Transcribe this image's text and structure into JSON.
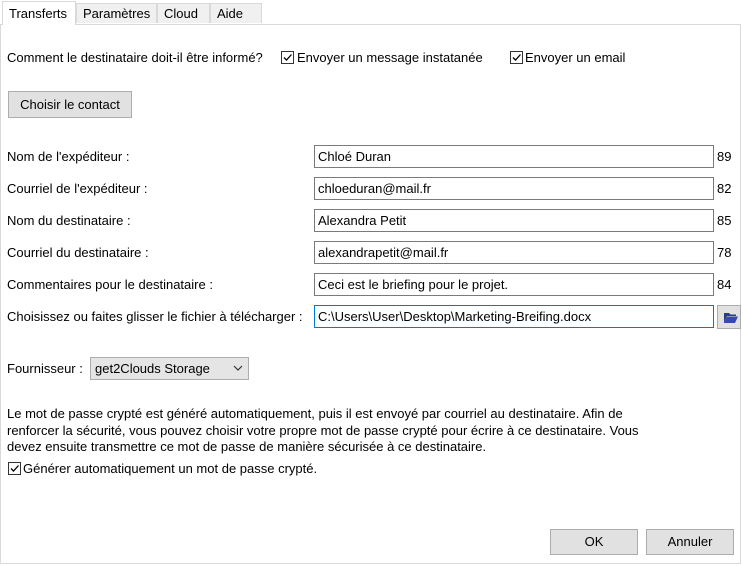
{
  "tabs": [
    {
      "label": "Transferts"
    },
    {
      "label": "Paramètres"
    },
    {
      "label": "Cloud"
    },
    {
      "label": "Aide"
    }
  ],
  "notify": {
    "question": "Comment le destinataire doit-il être informé?",
    "instant_label": "Envoyer un message instatanée",
    "instant_checked": true,
    "email_label": "Envoyer un email",
    "email_checked": true
  },
  "choose_contact_label": "Choisir le contact",
  "fields": {
    "sender_name": {
      "label": "Nom de l'expéditeur :",
      "value": "Chloé Duran",
      "count": "89"
    },
    "sender_email": {
      "label": "Courriel de l'expéditeur :",
      "value": "chloeduran@mail.fr",
      "count": "82"
    },
    "recipient_name": {
      "label": "Nom du destinataire :",
      "value": "Alexandra Petit",
      "count": "85"
    },
    "recipient_email": {
      "label": "Courriel du destinataire :",
      "value": "alexandrapetit@mail.fr",
      "count": "78"
    },
    "comments": {
      "label": "Commentaires pour le destinataire :",
      "value": "Ceci est le briefing pour le projet.",
      "count": "84"
    },
    "file": {
      "label": "Choisissez ou faites glisser le fichier à télécharger :",
      "value": "C:\\Users\\User\\Desktop\\Marketing-Breifing.docx"
    }
  },
  "provider": {
    "label": "Fournisseur :",
    "selected": "get2Clouds Storage"
  },
  "password_info": {
    "line1": "Le mot de passe crypté est généré automatiquement, puis il est envoyé par courriel au destinataire. Afin de",
    "line2": "renforcer la sécurité, vous pouvez choisir votre propre mot de passe crypté pour écrire à ce destinataire. Vous",
    "line3": "devez ensuite transmettre ce mot de passe de manière sécurisée à ce destinataire."
  },
  "auto_password": {
    "label": "Générer automatiquement un mot de passe crypté.",
    "checked": true
  },
  "buttons": {
    "ok": "OK",
    "cancel": "Annuler"
  }
}
